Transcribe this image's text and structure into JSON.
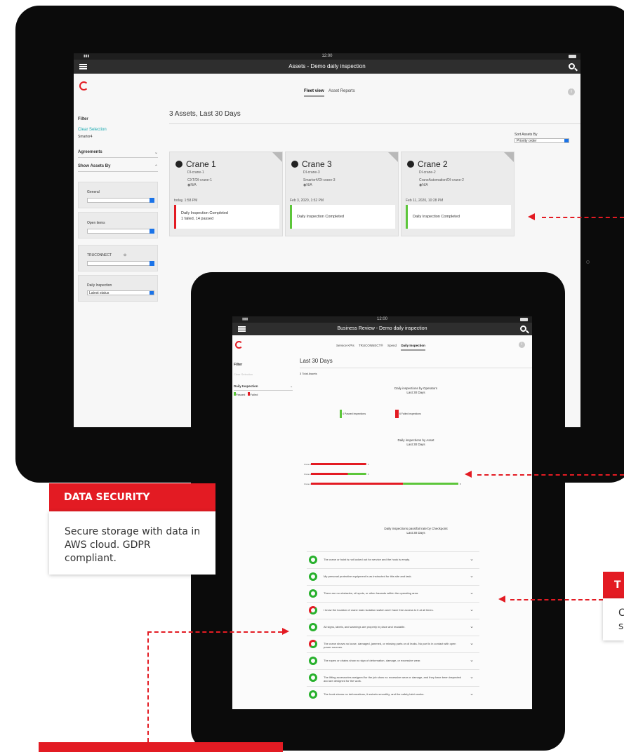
{
  "back_tablet": {
    "status_time": "12:00",
    "title": "Assets - Demo daily inspection",
    "tabs": [
      {
        "label": "Fleet view",
        "active": true
      },
      {
        "label": "Asset Reports",
        "active": false
      }
    ],
    "heading": "3 Assets, Last 30 Days",
    "filter": {
      "title": "Filter",
      "clear_selection": "Clear Selection",
      "selected": "Smartor4",
      "agreements": "Agreements",
      "show_assets_by": "Show Assets By",
      "controls": [
        {
          "label": "General",
          "value": ""
        },
        {
          "label": "Open items",
          "value": ""
        },
        {
          "label": "TRUCONNECT",
          "value": ""
        },
        {
          "label": "Daily Inspection",
          "value": "Latest status"
        }
      ]
    },
    "sort": {
      "label": "Sort Assets By",
      "value": "Priority order"
    },
    "cards": [
      {
        "name": "Crane 1",
        "id": "DI-crane-1",
        "path": "CXT/DI-crane-1",
        "location": "N/A",
        "date": "today, 1:58 PM",
        "status": "Daily Inspection Completed",
        "detail": "1 failed, 14 passed",
        "color": "#e31b23"
      },
      {
        "name": "Crane 3",
        "id": "DI-crane-3",
        "path": "Smartor4/DI-crane-3",
        "location": "N/A",
        "date": "Feb 3, 2020, 1:52 PM",
        "status": "Daily Inspection Completed",
        "detail": "",
        "color": "#5cc63a"
      },
      {
        "name": "Crane 2",
        "id": "DI-crane-2",
        "path": "CraneAutomation/DI-crane-2",
        "location": "N/A",
        "date": "Feb 11, 2020, 10:28 PM",
        "status": "Daily Inspection Completed",
        "detail": "",
        "color": "#5cc63a"
      }
    ]
  },
  "front_tablet": {
    "status_time": "12:00",
    "title": "Business Review - Demo daily inspection",
    "tabs": [
      {
        "label": "Service KPIs",
        "active": false
      },
      {
        "label": "TRUCONNECT®",
        "active": false
      },
      {
        "label": "Spend",
        "active": false
      },
      {
        "label": "Daily Inspection",
        "active": true
      }
    ],
    "filter": {
      "title": "Filter",
      "clear_selection": "Clear Selection",
      "group": "Daily Inspection",
      "legend_passed": "Passed",
      "legend_failed": "Failed"
    },
    "heading": "Last 30 Days",
    "total": "3 Total Assets",
    "by_operators": {
      "title": "Daily inspections by Operators",
      "subtitle": "Last 30 Days",
      "passed_count": "4",
      "passed_label": "Passed inspections",
      "failed_count": "6",
      "failed_label": "Failed inspections"
    },
    "by_asset": {
      "title": "Daily inspections by Asset",
      "subtitle": "Last 30 Days"
    },
    "by_checkpoint": {
      "title": "Daily inspections pass/fail rate by Checkpoint",
      "subtitle": "Last 30 Days"
    },
    "checkpoints": [
      {
        "text": "The crane or hoist is not locked out for service and the hook is empty.",
        "partial": false
      },
      {
        "text": "My personal protective equipment is as instructed for this site and task.",
        "partial": false
      },
      {
        "text": "There are no obstacles, oil spots, or other hazards within the operating area.",
        "partial": false
      },
      {
        "text": "I know the location of crane main isolation switch and I have free access to it at all times.",
        "partial": true
      },
      {
        "text": "All signs, labels, and warnings are properly in place and readable.",
        "partial": false
      },
      {
        "text": "The crane shows no loose, damaged, jammed, or missing parts or oil leaks. No part is in contact with open power sources.",
        "partial": true
      },
      {
        "text": "The ropes or chains show no sign of deformation, damage, or excessive wear.",
        "partial": false
      },
      {
        "text": "The lifting accessories assigned for the job show no excessive wear or damage, and they have been inspected and are designed for the work.",
        "partial": false
      },
      {
        "text": "The hook shows no deformations, it swivels smoothly, and the safety latch works.",
        "partial": false
      }
    ]
  },
  "chart_data": {
    "type": "bar",
    "categories": [
      "Crane 1",
      "Crane 2",
      "Crane 3"
    ],
    "series": [
      {
        "name": "Failed",
        "values": [
          3,
          2,
          5
        ],
        "color": "#e31b23"
      },
      {
        "name": "Passed",
        "values": [
          0,
          1,
          3
        ],
        "color": "#5cc63a"
      }
    ]
  },
  "callouts": {
    "data_security": {
      "title": "DATA SECURITY",
      "body": "Secure storage with data in AWS cloud. GDPR compliant."
    },
    "right_title_fragment": "T",
    "right_body_fragment_1": "C",
    "right_body_fragment_2": "s"
  }
}
